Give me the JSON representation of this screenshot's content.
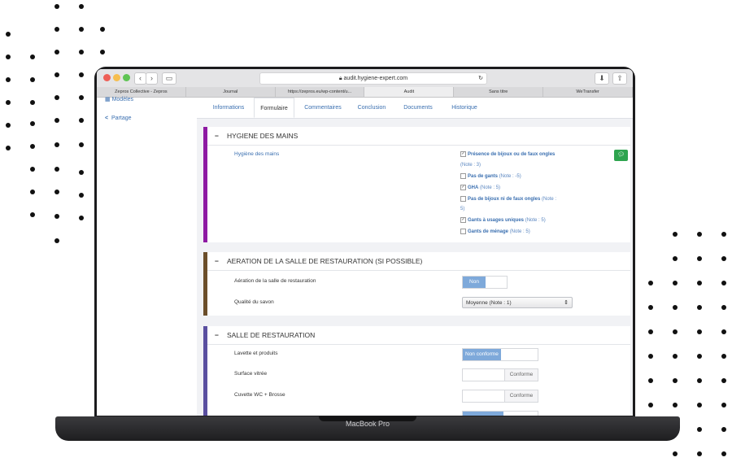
{
  "browser": {
    "url": "audit.hygiene-expert.com",
    "tabs": [
      "Zepros Collective - Zepros",
      "Journal",
      "https://zepros.eu/wp-content/u...",
      "Audit",
      "Sans titre",
      "WeTransfer"
    ],
    "active_tab": 3
  },
  "sidebar": {
    "items": [
      {
        "label": "Modèles"
      },
      {
        "label": "Partage"
      }
    ]
  },
  "page_tabs": [
    "Informations",
    "Formulaire",
    "Commentaires",
    "Conclusion",
    "Documents",
    "Historique"
  ],
  "active_page_tab": 1,
  "section1": {
    "title": "HYGIENE DES MAINS",
    "color": "#8e1aa3",
    "field_label": "Hygiène des mains",
    "options": [
      {
        "check": "✓",
        "label": "Présence de bijoux ou de faux ongles",
        "note": "(Note : 3)"
      },
      {
        "check": "",
        "label": "Pas de gants",
        "note": "(Note : -5)"
      },
      {
        "check": "✓",
        "label": "GHA",
        "note": "(Note : 5)"
      },
      {
        "check": "",
        "label": "Pas de bijoux ni de faux ongles",
        "note": "(Note :",
        "note2": "5)"
      },
      {
        "check": "✓",
        "label": "Gants à usages uniques",
        "note": "(Note : 5)"
      },
      {
        "check": "",
        "label": "Gants de ménage",
        "note": "(Note : 5)"
      }
    ]
  },
  "section2": {
    "title": "AERATION DE LA SALLE DE RESTAURATION (SI POSSIBLE)",
    "color": "#6b4e2a",
    "row1_label": "Aération de la salle de restauration",
    "row1_value": "Non",
    "row2_label": "Qualité du savon",
    "row2_value": "Moyenne (Note : 1)"
  },
  "section3": {
    "title": "SALLE DE RESTAURATION",
    "color": "#5a4fa0",
    "rows": [
      {
        "label": "Lavette et produits",
        "on": "Non conforme",
        "off": ""
      },
      {
        "label": "Surface vitrée",
        "on": "",
        "off": "Conforme"
      },
      {
        "label": "Cuvette WC + Brosse",
        "on": "",
        "off": "Conforme"
      }
    ]
  },
  "device": {
    "model": "MacBook Pro"
  },
  "colors": {
    "link": "#3a6fb0",
    "toggle_on": "#7ea9da",
    "chat_button": "#2ea44f"
  },
  "icons": {
    "chat": "chat-bubble-icon",
    "share": "share-icon",
    "models": "grid-icon"
  }
}
